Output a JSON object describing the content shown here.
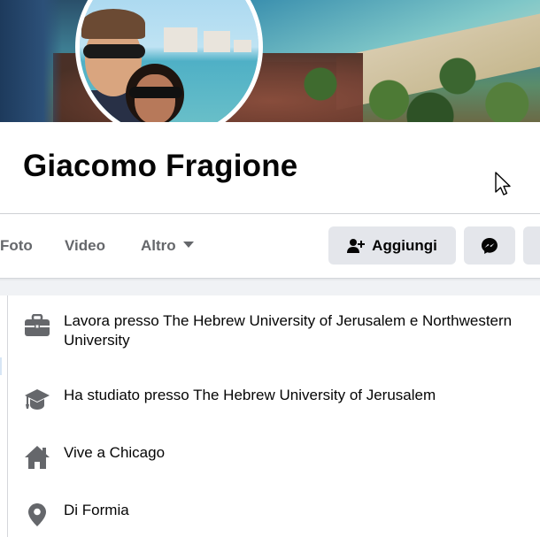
{
  "profile": {
    "name": "Giacomo Fragione"
  },
  "tabs": [
    {
      "label": "Foto"
    },
    {
      "label": "Video"
    },
    {
      "label": "Altro"
    }
  ],
  "actions": {
    "add_label": "Aggiungi"
  },
  "intro": {
    "items": [
      {
        "icon": "briefcase-icon",
        "text": "Lavora presso The Hebrew University of Jerusalem e Northwestern University"
      },
      {
        "icon": "graduation-cap-icon",
        "text": "Ha studiato presso The Hebrew University of Jerusalem"
      },
      {
        "icon": "home-icon",
        "text": "Vive a Chicago"
      },
      {
        "icon": "location-pin-icon",
        "text": "Di Formia"
      }
    ]
  },
  "colors": {
    "text_primary": "#050505",
    "text_secondary": "#65676b",
    "button_bg": "#e4e6eb",
    "icon_gray": "#65676b",
    "page_bg": "#f0f2f5"
  }
}
